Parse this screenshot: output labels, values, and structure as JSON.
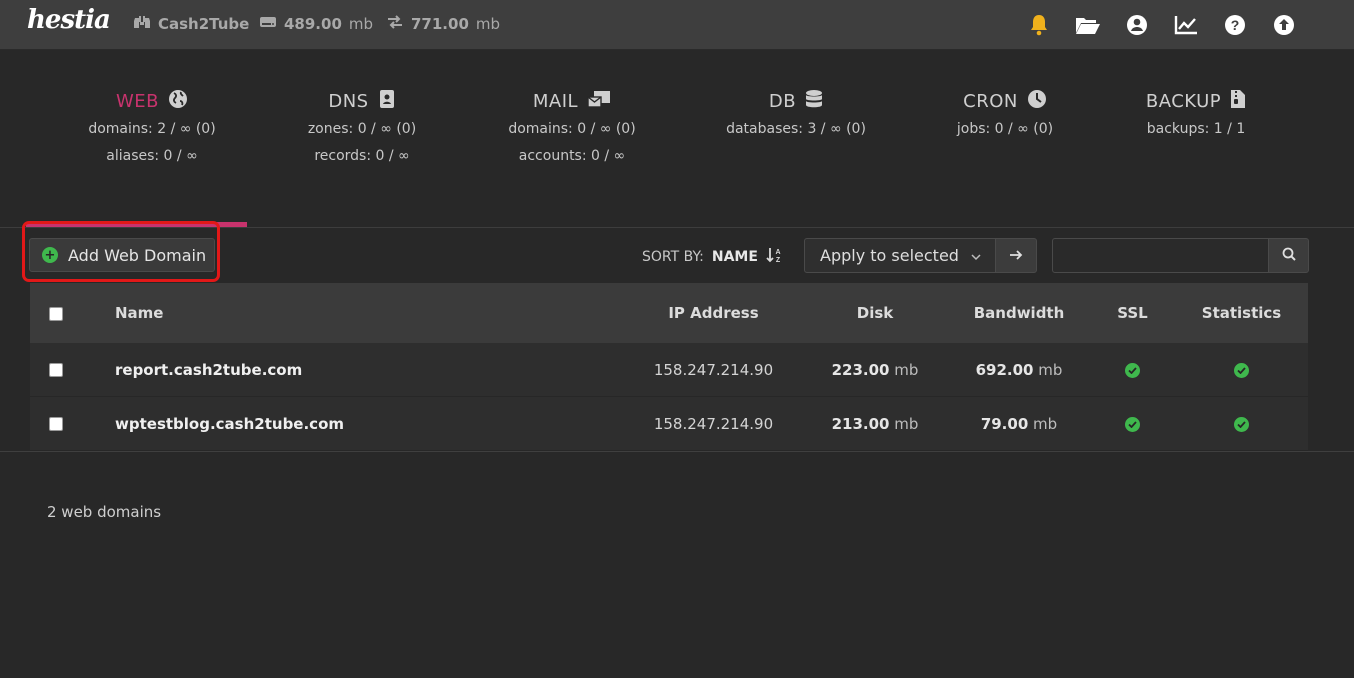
{
  "app": {
    "logo_text": "hestia"
  },
  "topbar": {
    "user": "Cash2Tube",
    "disk_value": "489.00",
    "disk_unit": "mb",
    "bandwidth_value": "771.00",
    "bandwidth_unit": "mb",
    "icons": [
      "bell-icon",
      "folder-icon",
      "user-circle-icon",
      "chart-line-icon",
      "help-icon",
      "upload-icon"
    ]
  },
  "summary": {
    "web": {
      "label": "WEB",
      "line1": "domains: 2 / ∞ (0)",
      "line2": "aliases: 0 / ∞"
    },
    "dns": {
      "label": "DNS",
      "line1": "zones: 0 / ∞ (0)",
      "line2": "records: 0 / ∞"
    },
    "mail": {
      "label": "MAIL",
      "line1": "domains: 0 / ∞ (0)",
      "line2": "accounts: 0 / ∞"
    },
    "db": {
      "label": "DB",
      "line1": "databases: 3 / ∞ (0)"
    },
    "cron": {
      "label": "CRON",
      "line1": "jobs: 0 / ∞ (0)"
    },
    "backup": {
      "label": "BACKUP",
      "line1": "backups: 1 / 1"
    }
  },
  "toolbar": {
    "add_label": "Add Web Domain",
    "sort_prefix": "SORT BY:",
    "sort_value": "NAME",
    "apply_label": "Apply to selected",
    "search_placeholder": ""
  },
  "table": {
    "headers": {
      "name": "Name",
      "ip": "IP Address",
      "disk": "Disk",
      "bandwidth": "Bandwidth",
      "ssl": "SSL",
      "stats": "Statistics"
    },
    "rows": [
      {
        "name": "report.cash2tube.com",
        "ip": "158.247.214.90",
        "disk": "223.00",
        "disk_unit": "mb",
        "bandwidth": "692.00",
        "bandwidth_unit": "mb",
        "ssl": true,
        "stats": true
      },
      {
        "name": "wptestblog.cash2tube.com",
        "ip": "158.247.214.90",
        "disk": "213.00",
        "disk_unit": "mb",
        "bandwidth": "79.00",
        "bandwidth_unit": "mb",
        "ssl": true,
        "stats": true
      }
    ]
  },
  "footer": {
    "count_label": "2 web domains"
  },
  "colors": {
    "accent": "#c8336d",
    "ok": "#3fb84d",
    "bell": "#f0b11c",
    "highlight": "#e21818"
  }
}
